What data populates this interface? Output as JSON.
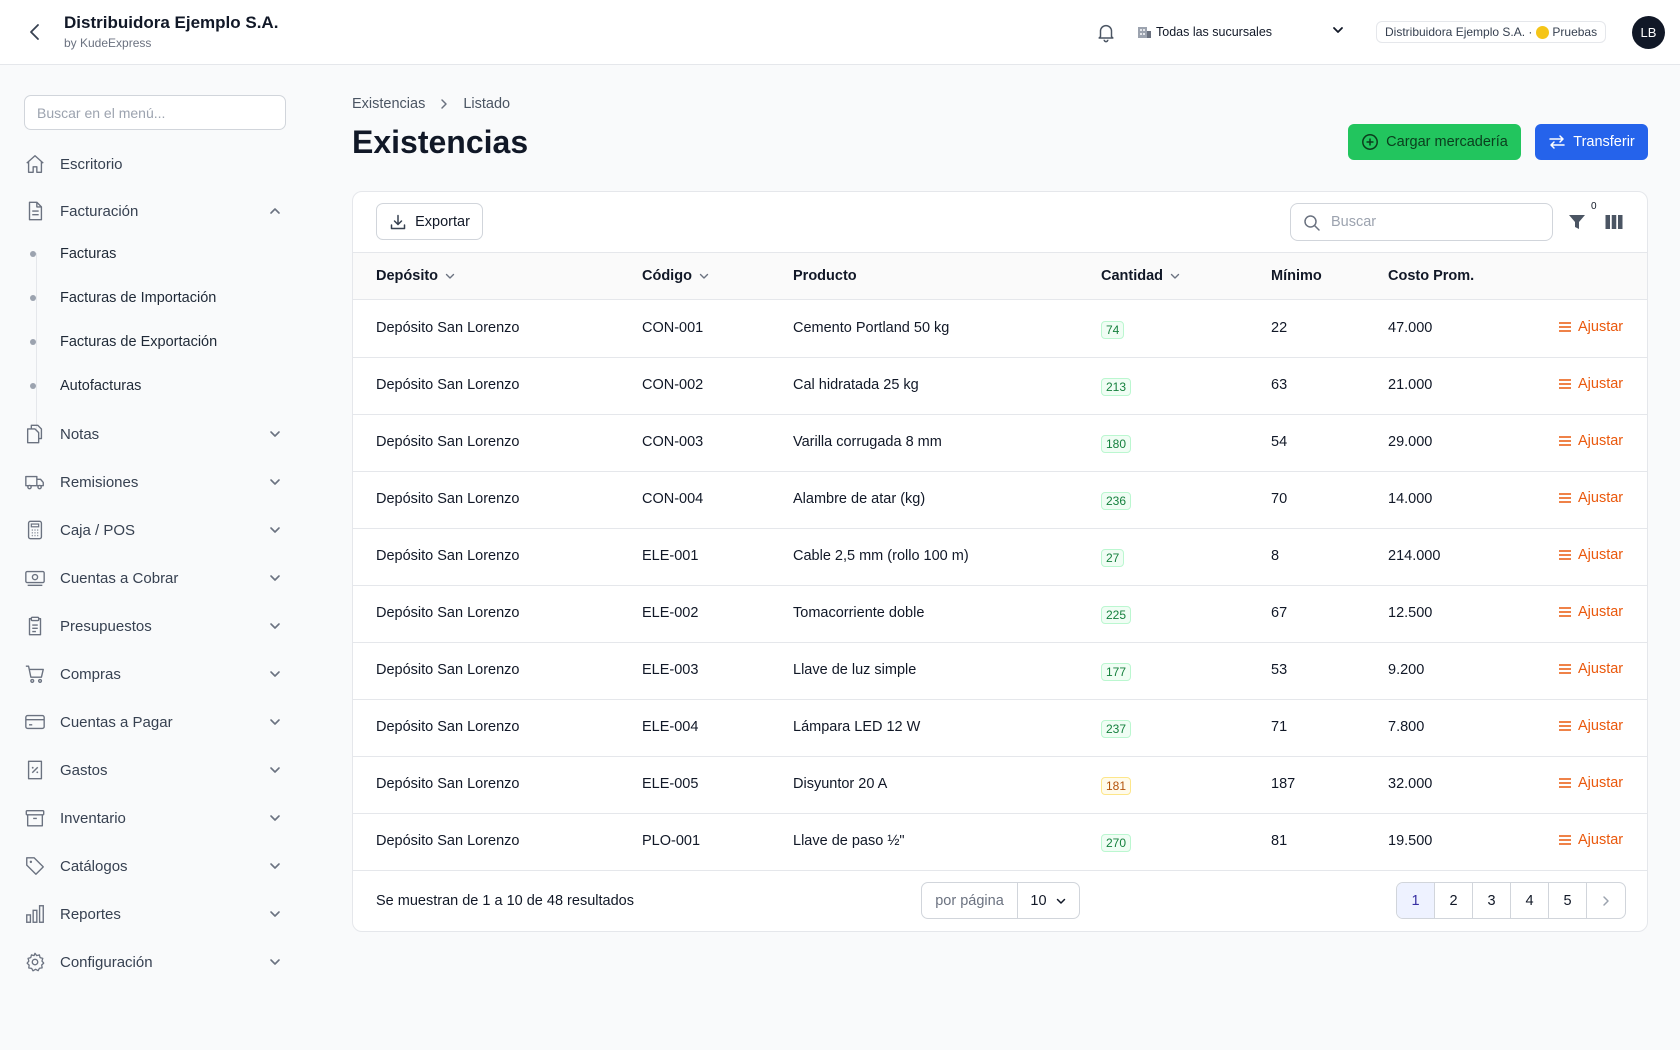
{
  "header": {
    "brand_title": "Distribuidora Ejemplo S.A.",
    "brand_sub": "by KudeExpress",
    "branch_select": "Todas las sucursales",
    "company_pill": "Distribuidora Ejemplo S.A. ·",
    "env_label": "Pruebas",
    "avatar_initials": "LB"
  },
  "sidebar": {
    "search_placeholder": "Buscar en el menú...",
    "items": [
      {
        "label": "Escritorio",
        "icon": "home-icon"
      },
      {
        "label": "Facturación",
        "icon": "document-icon",
        "expanded": true
      },
      {
        "label": "Notas",
        "icon": "notes-icon"
      },
      {
        "label": "Remisiones",
        "icon": "truck-icon"
      },
      {
        "label": "Caja / POS",
        "icon": "calculator-icon"
      },
      {
        "label": "Cuentas a Cobrar",
        "icon": "cash-icon"
      },
      {
        "label": "Presupuestos",
        "icon": "clipboard-icon"
      },
      {
        "label": "Compras",
        "icon": "cart-icon"
      },
      {
        "label": "Cuentas a Pagar",
        "icon": "credit-card-icon"
      },
      {
        "label": "Gastos",
        "icon": "receipt-icon"
      },
      {
        "label": "Inventario",
        "icon": "archive-icon"
      },
      {
        "label": "Catálogos",
        "icon": "tag-icon"
      },
      {
        "label": "Reportes",
        "icon": "chart-icon"
      },
      {
        "label": "Configuración",
        "icon": "gear-icon"
      }
    ],
    "sub_items": [
      "Facturas",
      "Facturas de Importación",
      "Facturas de Exportación",
      "Autofacturas"
    ]
  },
  "main": {
    "breadcrumb": [
      "Existencias",
      "Listado"
    ],
    "title": "Existencias",
    "btn_load": "Cargar mercadería",
    "btn_transfer": "Transferir",
    "export_label": "Exportar",
    "search_placeholder": "Buscar",
    "filter_count": "0",
    "columns": [
      "Depósito",
      "Código",
      "Producto",
      "Cantidad",
      "Mínimo",
      "Costo Prom."
    ],
    "adjust_label": "Ajustar",
    "rows": [
      {
        "deposito": "Depósito San Lorenzo",
        "codigo": "CON-001",
        "producto": "Cemento Portland 50 kg",
        "cantidad": "74",
        "minimo": "22",
        "costo": "47.000",
        "status": "ok"
      },
      {
        "deposito": "Depósito San Lorenzo",
        "codigo": "CON-002",
        "producto": "Cal hidratada 25 kg",
        "cantidad": "213",
        "minimo": "63",
        "costo": "21.000",
        "status": "ok"
      },
      {
        "deposito": "Depósito San Lorenzo",
        "codigo": "CON-003",
        "producto": "Varilla corrugada 8 mm",
        "cantidad": "180",
        "minimo": "54",
        "costo": "29.000",
        "status": "ok"
      },
      {
        "deposito": "Depósito San Lorenzo",
        "codigo": "CON-004",
        "producto": "Alambre de atar (kg)",
        "cantidad": "236",
        "minimo": "70",
        "costo": "14.000",
        "status": "ok"
      },
      {
        "deposito": "Depósito San Lorenzo",
        "codigo": "ELE-001",
        "producto": "Cable 2,5 mm (rollo 100 m)",
        "cantidad": "27",
        "minimo": "8",
        "costo": "214.000",
        "status": "ok"
      },
      {
        "deposito": "Depósito San Lorenzo",
        "codigo": "ELE-002",
        "producto": "Tomacorriente doble",
        "cantidad": "225",
        "minimo": "67",
        "costo": "12.500",
        "status": "ok"
      },
      {
        "deposito": "Depósito San Lorenzo",
        "codigo": "ELE-003",
        "producto": "Llave de luz simple",
        "cantidad": "177",
        "minimo": "53",
        "costo": "9.200",
        "status": "ok"
      },
      {
        "deposito": "Depósito San Lorenzo",
        "codigo": "ELE-004",
        "producto": "Lámpara LED 12 W",
        "cantidad": "237",
        "minimo": "71",
        "costo": "7.800",
        "status": "ok"
      },
      {
        "deposito": "Depósito San Lorenzo",
        "codigo": "ELE-005",
        "producto": "Disyuntor 20 A",
        "cantidad": "181",
        "minimo": "187",
        "costo": "32.000",
        "status": "warn"
      },
      {
        "deposito": "Depósito San Lorenzo",
        "codigo": "PLO-001",
        "producto": "Llave de paso ½\"",
        "cantidad": "270",
        "minimo": "81",
        "costo": "19.500",
        "status": "ok"
      }
    ],
    "results_text": "Se muestran de 1 a 10 de 48 resultados",
    "per_page_label": "por página",
    "per_page_value": "10",
    "pages": [
      "1",
      "2",
      "3",
      "4",
      "5"
    ],
    "current_page": "1"
  },
  "colors": {
    "accent_green": "#22c55e",
    "accent_blue": "#2563eb",
    "adjust_orange": "#ea580c",
    "env_dot": "#f5c518"
  }
}
